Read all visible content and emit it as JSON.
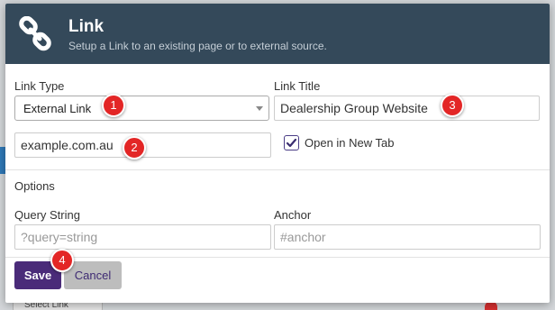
{
  "dialog": {
    "title": "Link",
    "subtitle": "Setup a Link to an existing page or to external source."
  },
  "fields": {
    "link_type_label": "Link Type",
    "link_type_value": "External Link",
    "link_title_label": "Link Title",
    "link_title_value": "Dealership Group Website",
    "url_value": "example.com.au",
    "open_new_tab_label": "Open in New Tab",
    "open_new_tab_checked": true
  },
  "options": {
    "heading": "Options",
    "query_string_label": "Query String",
    "query_string_placeholder": "?query=string",
    "anchor_label": "Anchor",
    "anchor_placeholder": "#anchor"
  },
  "buttons": {
    "save": "Save",
    "cancel": "Cancel"
  },
  "badges": [
    "1",
    "2",
    "3",
    "4"
  ],
  "background": {
    "bottom_button": "Select Link"
  },
  "colors": {
    "header_bg": "#34495a",
    "primary_button": "#4a2b79",
    "badge": "#e32626"
  },
  "icons": {
    "header": "chain-link-icon",
    "dropdown": "caret-down-icon",
    "checkbox": "checkmark-icon"
  }
}
